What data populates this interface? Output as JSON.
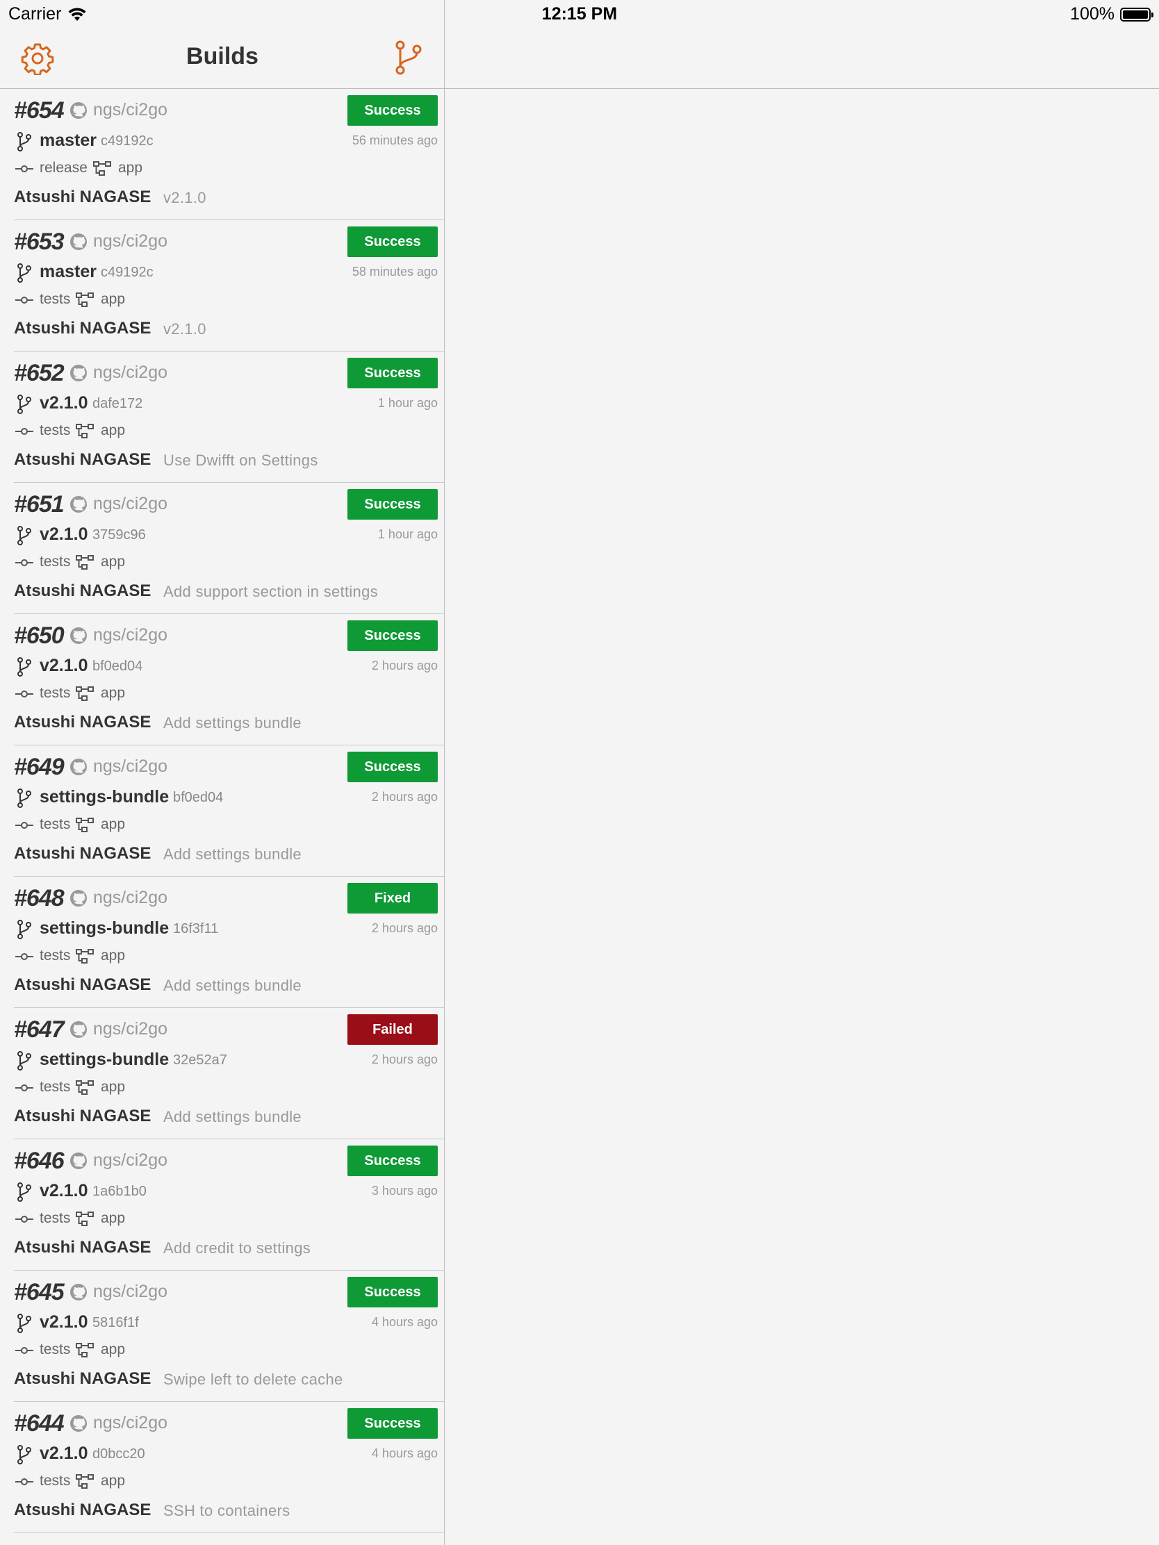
{
  "status_bar": {
    "carrier": "Carrier",
    "time": "12:15 PM",
    "battery": "100%"
  },
  "nav": {
    "title": "Builds",
    "left_icon": "gear-icon",
    "right_icon": "branch-icon"
  },
  "colors": {
    "accent": "#d8651c",
    "success": "#0e9a35",
    "failed": "#9a0f17"
  },
  "builds": [
    {
      "number": "#654",
      "repo": "ngs/ci2go",
      "status": "Success",
      "branch": "master",
      "sha": "c49192c",
      "time": "56 minutes ago",
      "job": "release",
      "workflow": "app",
      "author": "Atsushi NAGASE",
      "message": "v2.1.0"
    },
    {
      "number": "#653",
      "repo": "ngs/ci2go",
      "status": "Success",
      "branch": "master",
      "sha": "c49192c",
      "time": "58 minutes ago",
      "job": "tests",
      "workflow": "app",
      "author": "Atsushi NAGASE",
      "message": "v2.1.0"
    },
    {
      "number": "#652",
      "repo": "ngs/ci2go",
      "status": "Success",
      "branch": "v2.1.0",
      "sha": "dafe172",
      "time": "1 hour ago",
      "job": "tests",
      "workflow": "app",
      "author": "Atsushi NAGASE",
      "message": "Use Dwifft on Settings"
    },
    {
      "number": "#651",
      "repo": "ngs/ci2go",
      "status": "Success",
      "branch": "v2.1.0",
      "sha": "3759c96",
      "time": "1 hour ago",
      "job": "tests",
      "workflow": "app",
      "author": "Atsushi NAGASE",
      "message": "Add support section in settings"
    },
    {
      "number": "#650",
      "repo": "ngs/ci2go",
      "status": "Success",
      "branch": "v2.1.0",
      "sha": "bf0ed04",
      "time": "2 hours ago",
      "job": "tests",
      "workflow": "app",
      "author": "Atsushi NAGASE",
      "message": "Add settings bundle"
    },
    {
      "number": "#649",
      "repo": "ngs/ci2go",
      "status": "Success",
      "branch": "settings-bundle",
      "sha": "bf0ed04",
      "time": "2 hours ago",
      "job": "tests",
      "workflow": "app",
      "author": "Atsushi NAGASE",
      "message": "Add settings bundle"
    },
    {
      "number": "#648",
      "repo": "ngs/ci2go",
      "status": "Fixed",
      "branch": "settings-bundle",
      "sha": "16f3f11",
      "time": "2 hours ago",
      "job": "tests",
      "workflow": "app",
      "author": "Atsushi NAGASE",
      "message": "Add settings bundle"
    },
    {
      "number": "#647",
      "repo": "ngs/ci2go",
      "status": "Failed",
      "branch": "settings-bundle",
      "sha": "32e52a7",
      "time": "2 hours ago",
      "job": "tests",
      "workflow": "app",
      "author": "Atsushi NAGASE",
      "message": "Add settings bundle"
    },
    {
      "number": "#646",
      "repo": "ngs/ci2go",
      "status": "Success",
      "branch": "v2.1.0",
      "sha": "1a6b1b0",
      "time": "3 hours ago",
      "job": "tests",
      "workflow": "app",
      "author": "Atsushi NAGASE",
      "message": "Add credit to settings"
    },
    {
      "number": "#645",
      "repo": "ngs/ci2go",
      "status": "Success",
      "branch": "v2.1.0",
      "sha": "5816f1f",
      "time": "4 hours ago",
      "job": "tests",
      "workflow": "app",
      "author": "Atsushi NAGASE",
      "message": "Swipe left to delete cache"
    },
    {
      "number": "#644",
      "repo": "ngs/ci2go",
      "status": "Success",
      "branch": "v2.1.0",
      "sha": "d0bcc20",
      "time": "4 hours ago",
      "job": "tests",
      "workflow": "app",
      "author": "Atsushi NAGASE",
      "message": "SSH to containers"
    }
  ]
}
